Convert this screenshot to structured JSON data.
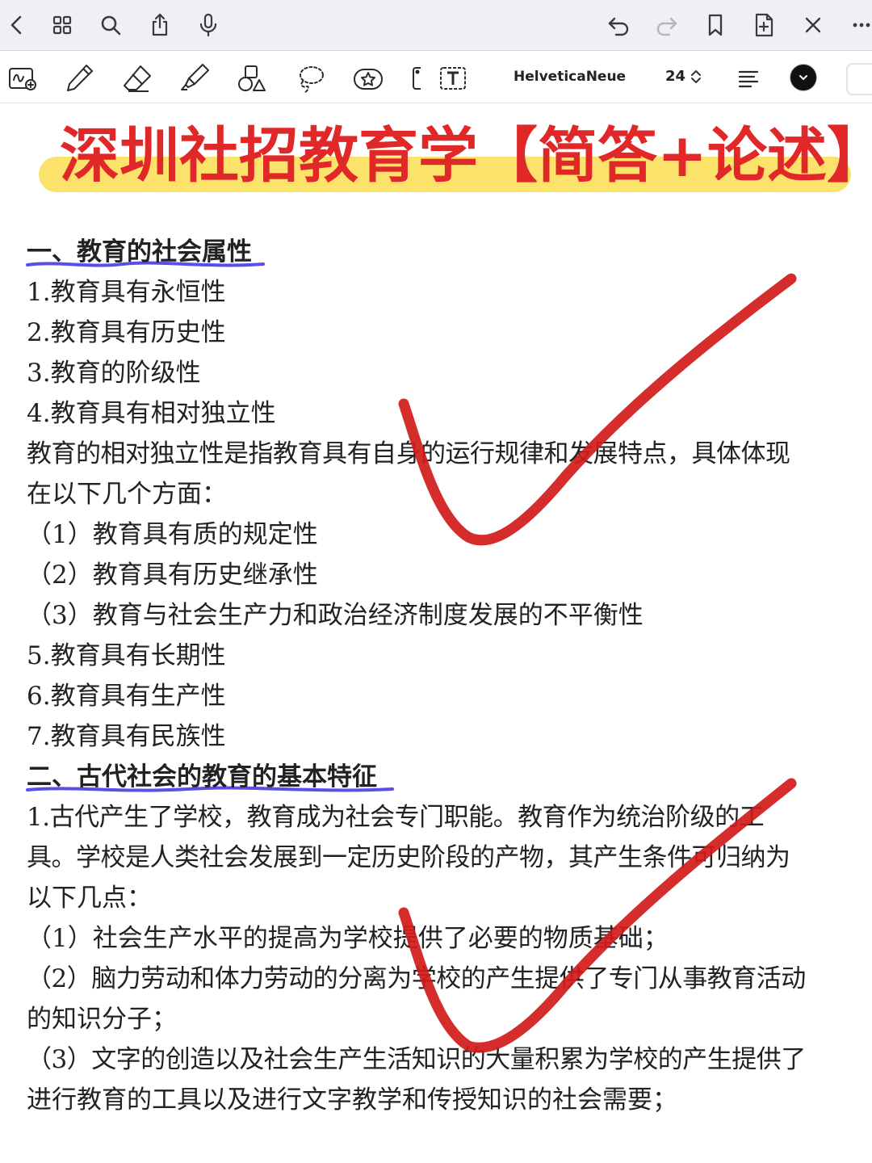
{
  "topbar": {
    "icons": [
      "back-chevron-icon",
      "grid-icon",
      "search-icon",
      "share-icon",
      "microphone-icon",
      "undo-icon",
      "redo-icon",
      "bookmark-icon",
      "add-page-icon",
      "close-icon",
      "more-icon"
    ]
  },
  "toolbar": {
    "font_name": "HelveticaNeue",
    "font_size": "24",
    "tools": [
      "handwriting-convert-icon",
      "pen-icon",
      "eraser-icon",
      "highlighter-icon",
      "shapes-icon",
      "lasso-icon",
      "sticker-icon",
      "image-icon",
      "text-tool-icon"
    ]
  },
  "document": {
    "title": "深圳社招教育学【简答+论述】",
    "lines": [
      "一、教育的社会属性",
      "1.教育具有永恒性",
      "2.教育具有历史性",
      "3.教育的阶级性",
      "4.教育具有相对独立性",
      "教育的相对独立性是指教育具有自身的运行规律和发展特点，具体体现",
      "在以下几个方面：",
      "（1）教育具有质的规定性",
      "（2）教育具有历史继承性",
      "（3）教育与社会生产力和政治经济制度发展的不平衡性",
      "5.教育具有长期性",
      "6.教育具有生产性",
      "7.教育具有民族性",
      "二、古代社会的教育的基本特征",
      "1.古代产生了学校，教育成为社会专门职能。教育作为统治阶级的工",
      "具。学校是人类社会发展到一定历史阶段的产物，其产生条件可归纳为",
      "以下几点：",
      "（1）社会生产水平的提高为学校提供了必要的物质基础；",
      "（2）脑力劳动和体力劳动的分离为学校的产生提供了专门从事教育活动",
      "的知识分子；",
      "（3）文字的创造以及社会生产生活知识的大量积累为学校的产生提供了",
      "进行教育的工具以及进行文字教学和传授知识的社会需要；"
    ]
  },
  "colors": {
    "title_red": "#e02828",
    "title_highlight": "#fbe26a",
    "check_red": "#d11a1a",
    "underline_purple": "#5b4ee8",
    "toolbar_bg": "#eef0f4"
  }
}
